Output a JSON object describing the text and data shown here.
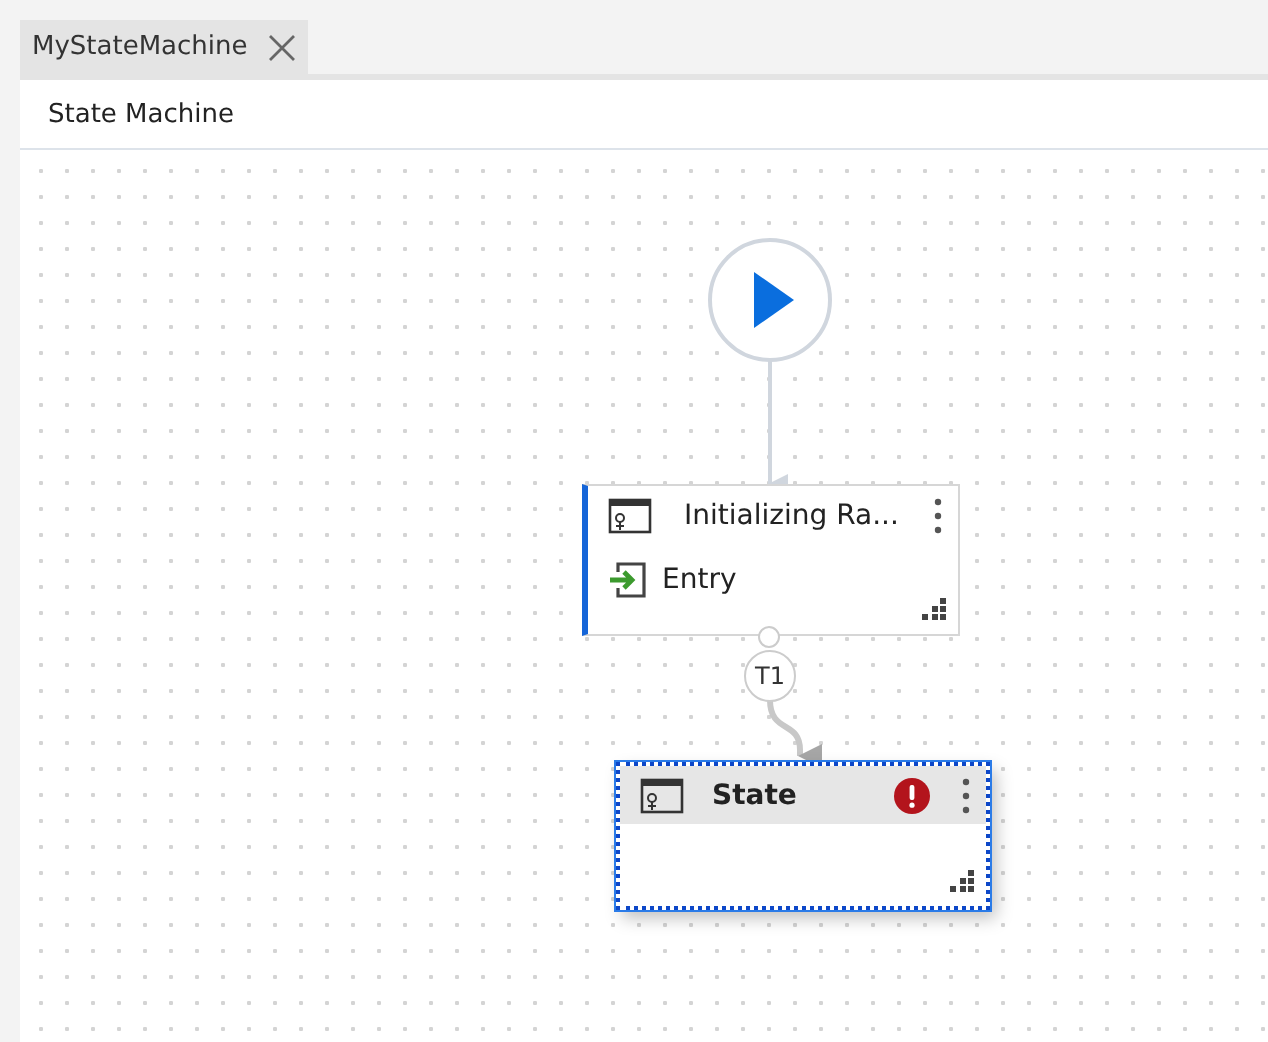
{
  "tab": {
    "label": "MyStateMachine"
  },
  "breadcrumb": "State Machine",
  "states": [
    {
      "title": "Initializing Ra...",
      "selected": false,
      "highlighted": true,
      "error": false,
      "actions": [
        "Entry"
      ]
    },
    {
      "title": "State",
      "selected": true,
      "highlighted": false,
      "error": true
    }
  ],
  "transitions": [
    {
      "label": "T1"
    }
  ]
}
